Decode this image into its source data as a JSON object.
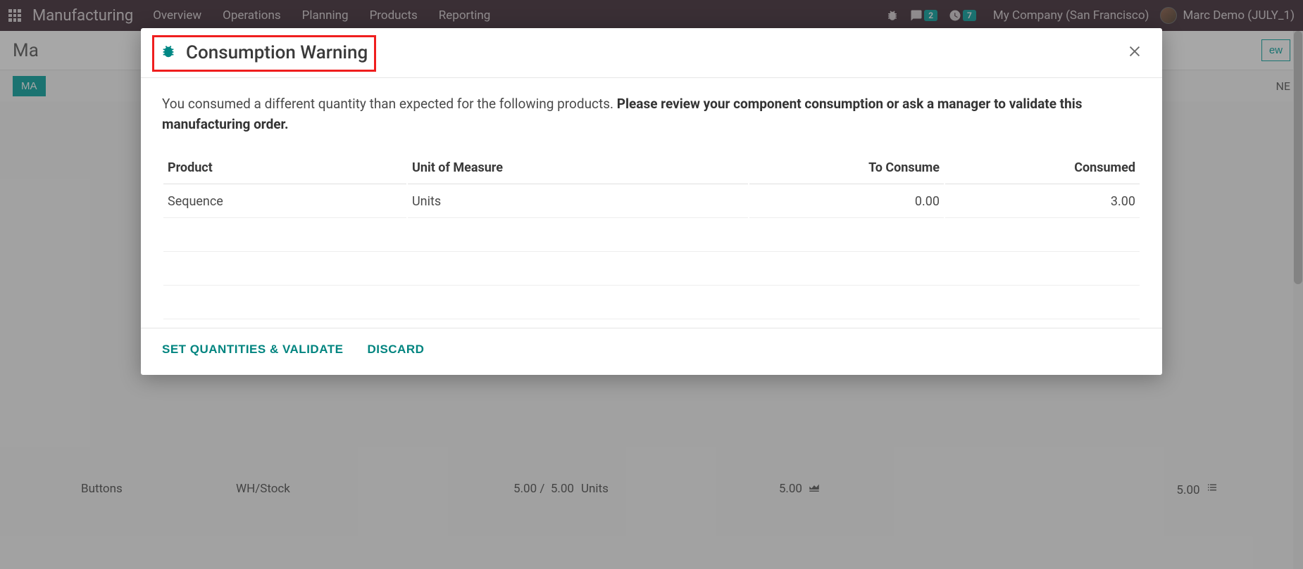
{
  "navbar": {
    "title": "Manufacturing",
    "links": [
      "Overview",
      "Operations",
      "Planning",
      "Products",
      "Reporting"
    ],
    "chat_badge": "2",
    "clock_badge": "7",
    "company": "My Company (San Francisco)",
    "user": "Marc Demo (JULY_1)"
  },
  "breadcrumb": {
    "text": "Ma",
    "right_btn": "ew"
  },
  "action_bar": {
    "btn": "MA",
    "right": "NE"
  },
  "bg_row": {
    "product": "Buttons",
    "location": "WH/Stock",
    "qty_done": "5.00 /",
    "qty_total": "5.00",
    "uom": "Units",
    "col5": "5.00",
    "col6": "5.00"
  },
  "modal": {
    "title": "Consumption Warning",
    "text_plain": "You consumed a different quantity than expected for the following products. ",
    "text_bold": "Please review your component consumption or ask a manager to validate this manufacturing order.",
    "columns": {
      "product": "Product",
      "uom": "Unit of Measure",
      "to_consume": "To Consume",
      "consumed": "Consumed"
    },
    "rows": [
      {
        "product": "Sequence",
        "uom": "Units",
        "to_consume": "0.00",
        "consumed": "3.00"
      }
    ],
    "footer": {
      "validate": "SET QUANTITIES & VALIDATE",
      "discard": "DISCARD"
    }
  }
}
